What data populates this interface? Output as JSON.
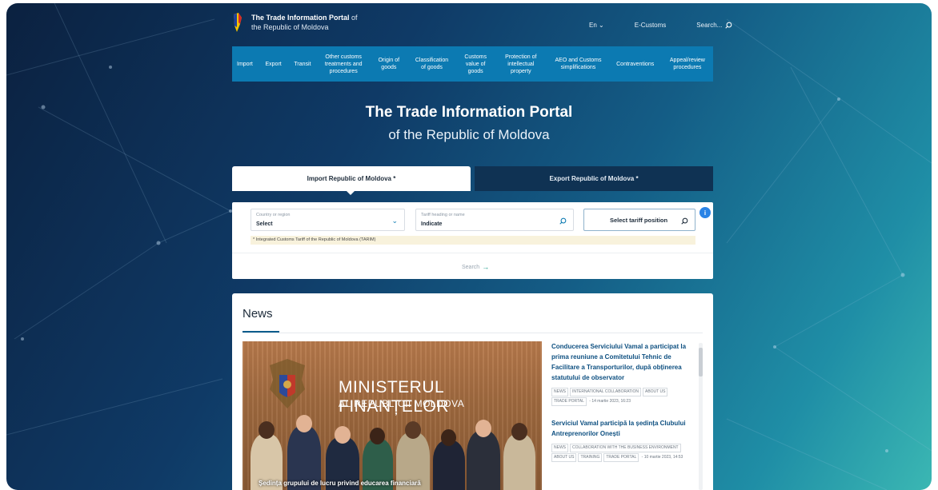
{
  "header": {
    "logo_title": "The Trade Information Portal",
    "logo_of": " of",
    "logo_subtitle": "the Republic of Moldova",
    "lang": "En",
    "ecustoms": "E-Customs",
    "search": "Search..."
  },
  "nav": [
    "Import",
    "Export",
    "Transit",
    "Other customs treatments and procedures",
    "Origin of goods",
    "Classification of goods",
    "Customs value of goods",
    "Protection of intellectual property",
    "AEO and Customs simplifications",
    "Contraventions",
    "Appeal/review procedures"
  ],
  "hero": {
    "title": "The Trade Information Portal",
    "subtitle": "of the Republic of Moldova"
  },
  "tabs": {
    "import": "Import Republic of Moldova *",
    "export": "Export Republic of Moldova *"
  },
  "search_form": {
    "country_label": "Country or region",
    "country_value": "Select",
    "tariff_label": "Tariff heading or name",
    "tariff_value": "Indicate",
    "select_tariff": "Select tariff position",
    "note": "* Integrated Customs Tariff of the Republic of Moldova (TARIM)",
    "search_label": "Search",
    "info": "i"
  },
  "news": {
    "heading": "News",
    "image_title": "MINISTERUL FINANȚELOR",
    "image_subtitle": "AL REPUBLICII MOLDOVA",
    "image_caption": "Ședința grupului de lucru privind educarea financiară",
    "items": [
      {
        "title": "Conducerea Serviciului Vamal a participat la prima reuniune a Comitetului Tehnic de Facilitare a Transporturilor, după obținerea statutului de observator",
        "tags": [
          "NEWS",
          "INTERNATIONAL COLLABORATION",
          "ABOUT US",
          "TRADE PORTAL"
        ],
        "date": "- 14 martie 2023, 16:23"
      },
      {
        "title": "Serviciul Vamal participă la ședința Clubului Antreprenorilor Onești",
        "tags": [
          "NEWS",
          "COLLABORATION WITH THE BUSINESS ENVIRONMENT",
          "ABOUT US",
          "TRAINING",
          "TRADE PORTAL"
        ],
        "date": "- 10 martie 2023, 14:53"
      }
    ]
  },
  "colors": {
    "nav_bg": "#0c7ab2",
    "export_tab": "#0f3253",
    "accent": "#0d4f80"
  }
}
